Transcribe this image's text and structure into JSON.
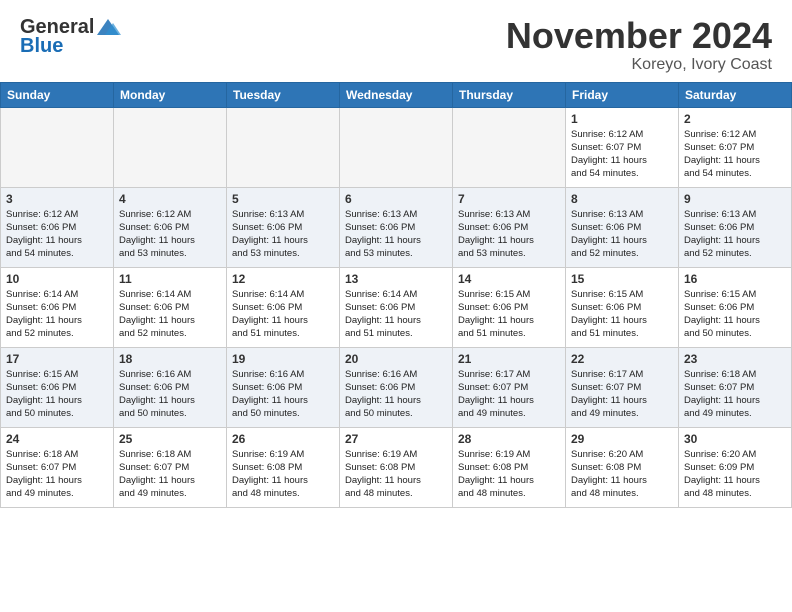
{
  "header": {
    "logo_general": "General",
    "logo_blue": "Blue",
    "month_title": "November 2024",
    "location": "Koreyo, Ivory Coast"
  },
  "weekdays": [
    "Sunday",
    "Monday",
    "Tuesday",
    "Wednesday",
    "Thursday",
    "Friday",
    "Saturday"
  ],
  "weeks": [
    {
      "shaded": false,
      "days": [
        {
          "date": "",
          "info": ""
        },
        {
          "date": "",
          "info": ""
        },
        {
          "date": "",
          "info": ""
        },
        {
          "date": "",
          "info": ""
        },
        {
          "date": "",
          "info": ""
        },
        {
          "date": "1",
          "info": "Sunrise: 6:12 AM\nSunset: 6:07 PM\nDaylight: 11 hours\nand 54 minutes."
        },
        {
          "date": "2",
          "info": "Sunrise: 6:12 AM\nSunset: 6:07 PM\nDaylight: 11 hours\nand 54 minutes."
        }
      ]
    },
    {
      "shaded": true,
      "days": [
        {
          "date": "3",
          "info": "Sunrise: 6:12 AM\nSunset: 6:06 PM\nDaylight: 11 hours\nand 54 minutes."
        },
        {
          "date": "4",
          "info": "Sunrise: 6:12 AM\nSunset: 6:06 PM\nDaylight: 11 hours\nand 53 minutes."
        },
        {
          "date": "5",
          "info": "Sunrise: 6:13 AM\nSunset: 6:06 PM\nDaylight: 11 hours\nand 53 minutes."
        },
        {
          "date": "6",
          "info": "Sunrise: 6:13 AM\nSunset: 6:06 PM\nDaylight: 11 hours\nand 53 minutes."
        },
        {
          "date": "7",
          "info": "Sunrise: 6:13 AM\nSunset: 6:06 PM\nDaylight: 11 hours\nand 53 minutes."
        },
        {
          "date": "8",
          "info": "Sunrise: 6:13 AM\nSunset: 6:06 PM\nDaylight: 11 hours\nand 52 minutes."
        },
        {
          "date": "9",
          "info": "Sunrise: 6:13 AM\nSunset: 6:06 PM\nDaylight: 11 hours\nand 52 minutes."
        }
      ]
    },
    {
      "shaded": false,
      "days": [
        {
          "date": "10",
          "info": "Sunrise: 6:14 AM\nSunset: 6:06 PM\nDaylight: 11 hours\nand 52 minutes."
        },
        {
          "date": "11",
          "info": "Sunrise: 6:14 AM\nSunset: 6:06 PM\nDaylight: 11 hours\nand 52 minutes."
        },
        {
          "date": "12",
          "info": "Sunrise: 6:14 AM\nSunset: 6:06 PM\nDaylight: 11 hours\nand 51 minutes."
        },
        {
          "date": "13",
          "info": "Sunrise: 6:14 AM\nSunset: 6:06 PM\nDaylight: 11 hours\nand 51 minutes."
        },
        {
          "date": "14",
          "info": "Sunrise: 6:15 AM\nSunset: 6:06 PM\nDaylight: 11 hours\nand 51 minutes."
        },
        {
          "date": "15",
          "info": "Sunrise: 6:15 AM\nSunset: 6:06 PM\nDaylight: 11 hours\nand 51 minutes."
        },
        {
          "date": "16",
          "info": "Sunrise: 6:15 AM\nSunset: 6:06 PM\nDaylight: 11 hours\nand 50 minutes."
        }
      ]
    },
    {
      "shaded": true,
      "days": [
        {
          "date": "17",
          "info": "Sunrise: 6:15 AM\nSunset: 6:06 PM\nDaylight: 11 hours\nand 50 minutes."
        },
        {
          "date": "18",
          "info": "Sunrise: 6:16 AM\nSunset: 6:06 PM\nDaylight: 11 hours\nand 50 minutes."
        },
        {
          "date": "19",
          "info": "Sunrise: 6:16 AM\nSunset: 6:06 PM\nDaylight: 11 hours\nand 50 minutes."
        },
        {
          "date": "20",
          "info": "Sunrise: 6:16 AM\nSunset: 6:06 PM\nDaylight: 11 hours\nand 50 minutes."
        },
        {
          "date": "21",
          "info": "Sunrise: 6:17 AM\nSunset: 6:07 PM\nDaylight: 11 hours\nand 49 minutes."
        },
        {
          "date": "22",
          "info": "Sunrise: 6:17 AM\nSunset: 6:07 PM\nDaylight: 11 hours\nand 49 minutes."
        },
        {
          "date": "23",
          "info": "Sunrise: 6:18 AM\nSunset: 6:07 PM\nDaylight: 11 hours\nand 49 minutes."
        }
      ]
    },
    {
      "shaded": false,
      "days": [
        {
          "date": "24",
          "info": "Sunrise: 6:18 AM\nSunset: 6:07 PM\nDaylight: 11 hours\nand 49 minutes."
        },
        {
          "date": "25",
          "info": "Sunrise: 6:18 AM\nSunset: 6:07 PM\nDaylight: 11 hours\nand 49 minutes."
        },
        {
          "date": "26",
          "info": "Sunrise: 6:19 AM\nSunset: 6:08 PM\nDaylight: 11 hours\nand 48 minutes."
        },
        {
          "date": "27",
          "info": "Sunrise: 6:19 AM\nSunset: 6:08 PM\nDaylight: 11 hours\nand 48 minutes."
        },
        {
          "date": "28",
          "info": "Sunrise: 6:19 AM\nSunset: 6:08 PM\nDaylight: 11 hours\nand 48 minutes."
        },
        {
          "date": "29",
          "info": "Sunrise: 6:20 AM\nSunset: 6:08 PM\nDaylight: 11 hours\nand 48 minutes."
        },
        {
          "date": "30",
          "info": "Sunrise: 6:20 AM\nSunset: 6:09 PM\nDaylight: 11 hours\nand 48 minutes."
        }
      ]
    }
  ]
}
